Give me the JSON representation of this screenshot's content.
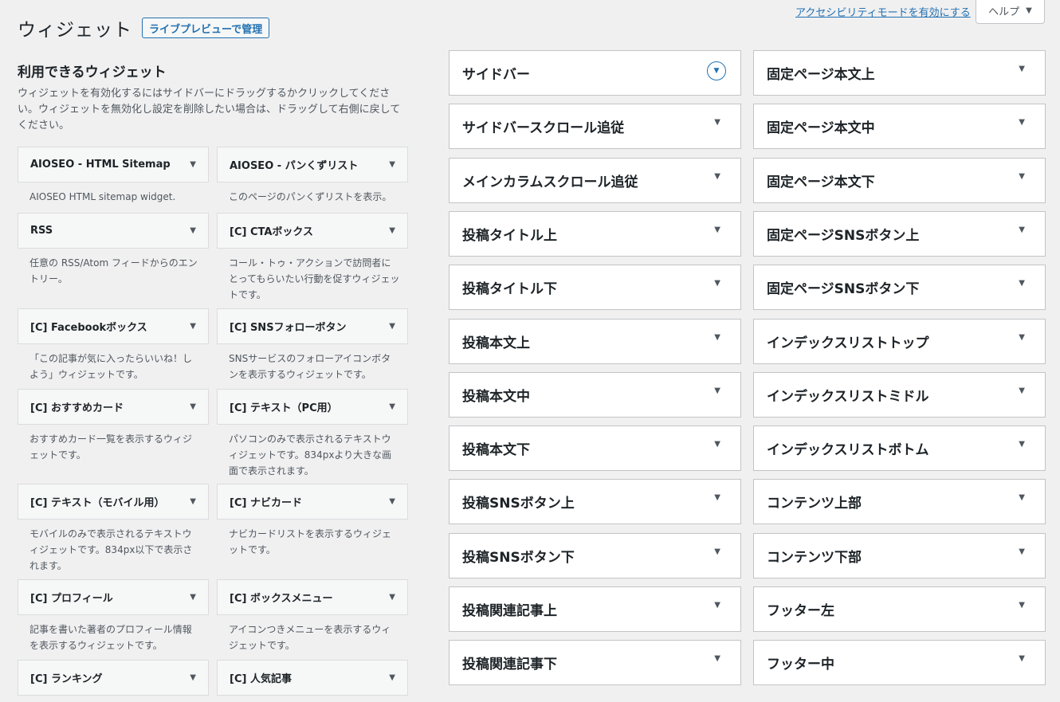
{
  "header": {
    "title": "ウィジェット",
    "manage_button": "ライブプレビューで管理",
    "a11y_link": "アクセシビリティモードを有効にする",
    "help": "ヘルプ"
  },
  "available": {
    "heading": "利用できるウィジェット",
    "description": "ウィジェットを有効化するにはサイドバーにドラッグするかクリックしてください。ウィジェットを無効化し設定を削除したい場合は、ドラッグして右側に戻してください。"
  },
  "widgets": [
    {
      "title": "AIOSEO - HTML Sitemap",
      "desc": "AIOSEO HTML sitemap widget."
    },
    {
      "title": "AIOSEO - パンくずリスト",
      "desc": "このページのパンくずリストを表示。"
    },
    {
      "title": "RSS",
      "desc": "任意の RSS/Atom フィードからのエントリー。"
    },
    {
      "title": "[C] CTAボックス",
      "desc": "コール・トゥ・アクションで訪問者にとってもらいたい行動を促すウィジェットです。"
    },
    {
      "title": "[C] Facebookボックス",
      "desc": "「この記事が気に入ったらいいね！しよう」ウィジェットです。"
    },
    {
      "title": "[C] SNSフォローボタン",
      "desc": "SNSサービスのフォローアイコンボタンを表示するウィジェットです。"
    },
    {
      "title": "[C] おすすめカード",
      "desc": "おすすめカード一覧を表示するウィジェットです。"
    },
    {
      "title": "[C] テキスト（PC用）",
      "desc": "パソコンのみで表示されるテキストウィジェットです。834pxより大きな画面で表示されます。"
    },
    {
      "title": "[C] テキスト（モバイル用）",
      "desc": "モバイルのみで表示されるテキストウィジェットです。834px以下で表示されます。"
    },
    {
      "title": "[C] ナビカード",
      "desc": "ナビカードリストを表示するウィジェットです。"
    },
    {
      "title": "[C] プロフィール",
      "desc": "記事を書いた著者のプロフィール情報を表示するウィジェットです。"
    },
    {
      "title": "[C] ボックスメニュー",
      "desc": "アイコンつきメニューを表示するウィジェットです。"
    },
    {
      "title": "[C] ランキング",
      "desc": ""
    },
    {
      "title": "[C] 人気記事",
      "desc": ""
    }
  ],
  "sidebars_left": [
    "サイドバー",
    "サイドバースクロール追従",
    "メインカラムスクロール追従",
    "投稿タイトル上",
    "投稿タイトル下",
    "投稿本文上",
    "投稿本文中",
    "投稿本文下",
    "投稿SNSボタン上",
    "投稿SNSボタン下",
    "投稿関連記事上",
    "投稿関連記事下"
  ],
  "sidebars_right": [
    "固定ページ本文上",
    "固定ページ本文中",
    "固定ページ本文下",
    "固定ページSNSボタン上",
    "固定ページSNSボタン下",
    "インデックスリストトップ",
    "インデックスリストミドル",
    "インデックスリストボトム",
    "コンテンツ上部",
    "コンテンツ下部",
    "フッター左",
    "フッター中"
  ]
}
